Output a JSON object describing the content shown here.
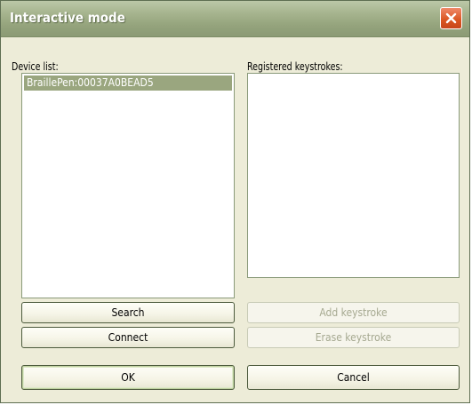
{
  "window": {
    "title": "Interactive mode"
  },
  "device_list": {
    "label": "Device list:",
    "items": [
      {
        "label": "BraillePen:00037A0BEAD5",
        "selected": true
      }
    ]
  },
  "keystrokes": {
    "label": "Registered keystrokes:",
    "items": []
  },
  "buttons": {
    "search": "Search",
    "connect": "Connect",
    "add_keystroke": "Add keystroke",
    "erase_keystroke": "Erase keystroke",
    "ok": "OK",
    "cancel": "Cancel"
  },
  "colors": {
    "title_bar": "#a6b48e",
    "close_button": "#d9541f",
    "selection": "#9aa67f",
    "dialog_background": "#edecd8"
  },
  "icons": {
    "close": "close-icon"
  }
}
